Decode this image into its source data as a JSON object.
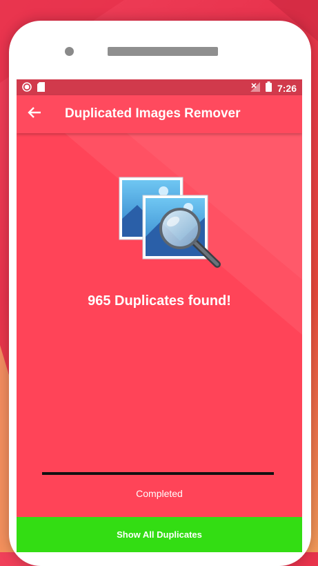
{
  "status_bar": {
    "time": "7:26",
    "icons": [
      "record-icon",
      "sd-card-icon",
      "no-signal-icon",
      "battery-icon"
    ]
  },
  "app_bar": {
    "back_icon": "arrow-left-icon",
    "title": "Duplicated Images Remover"
  },
  "main": {
    "hero_icon": "duplicate-images-search-icon",
    "result_text": "965 Duplicates found!",
    "progress_fraction": 1.0,
    "progress_status": "Completed"
  },
  "footer": {
    "action_label": "Show All Duplicates"
  },
  "colors": {
    "screen_background": "#ff4458",
    "status_bar": "#d13a4c",
    "app_bar": "#ff4a5e",
    "progress_bar": "#111111",
    "action_button": "#33dd13"
  }
}
